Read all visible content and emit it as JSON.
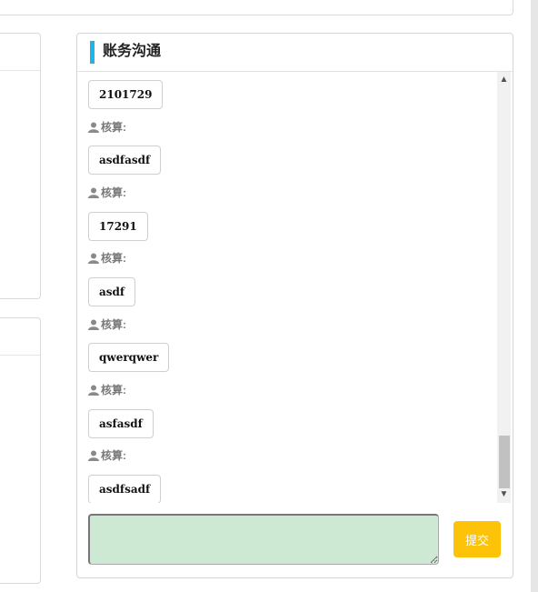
{
  "panel": {
    "title": "账务沟通"
  },
  "messages": [
    {
      "sender": null,
      "text": "2101729"
    },
    {
      "sender": "核算:",
      "text": "asdfasdf"
    },
    {
      "sender": "核算:",
      "text": "17291"
    },
    {
      "sender": "核算:",
      "text": "asdf"
    },
    {
      "sender": "核算:",
      "text": "qwerqwer"
    },
    {
      "sender": "核算:",
      "text": "asfasdf"
    },
    {
      "sender": "核算:",
      "text": "asdfsadf"
    }
  ],
  "reply": {
    "value": "",
    "submit_label": "提交"
  },
  "colors": {
    "accent": "#1cb6e6",
    "submit": "#fdc308",
    "input_bg": "#cde8d3"
  }
}
